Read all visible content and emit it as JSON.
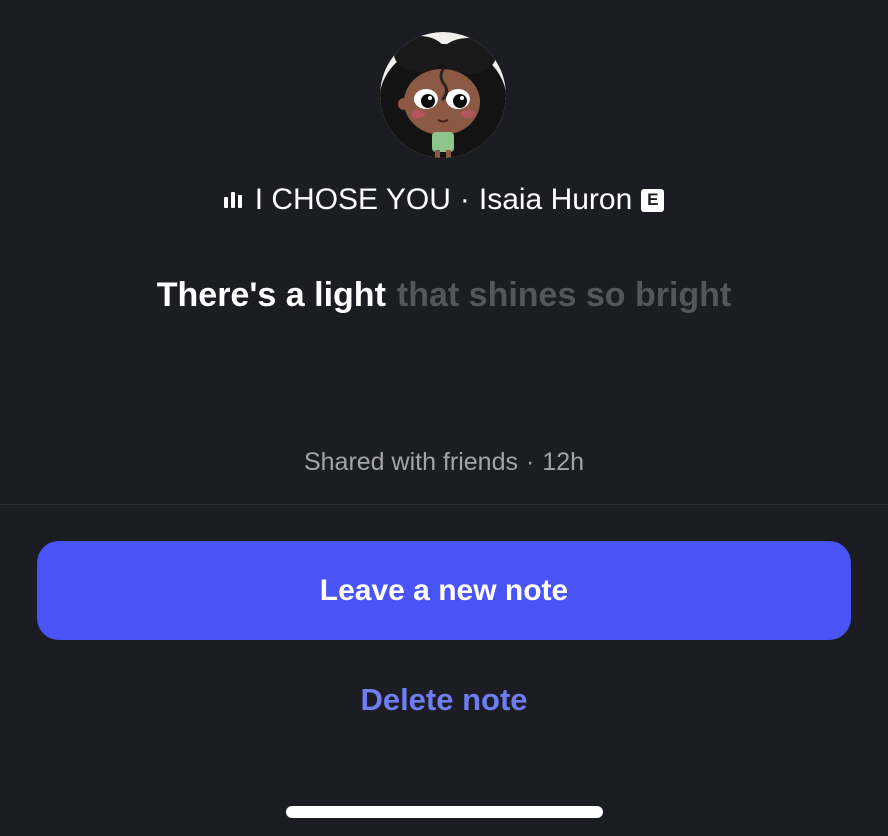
{
  "note": {
    "avatar_alt": "illustrated girl avatar",
    "song": {
      "icon": "playing-bars-icon",
      "title": "I CHOSE YOU",
      "separator": "·",
      "artist": "Isaia Huron",
      "explicit_badge": "E"
    },
    "lyric": {
      "sung": "There's a light",
      "upcoming": "that shines so bright"
    },
    "shared": {
      "audience": "Shared with friends",
      "separator": "·",
      "age": "12h"
    }
  },
  "actions": {
    "primary_label": "Leave a new note",
    "delete_label": "Delete note"
  },
  "colors": {
    "background": "#1c1d22",
    "primary_button": "#4a53f6",
    "delete_link": "#6f7df0",
    "upcoming_lyric": "#55565c",
    "muted_text": "#a3a4aa"
  }
}
